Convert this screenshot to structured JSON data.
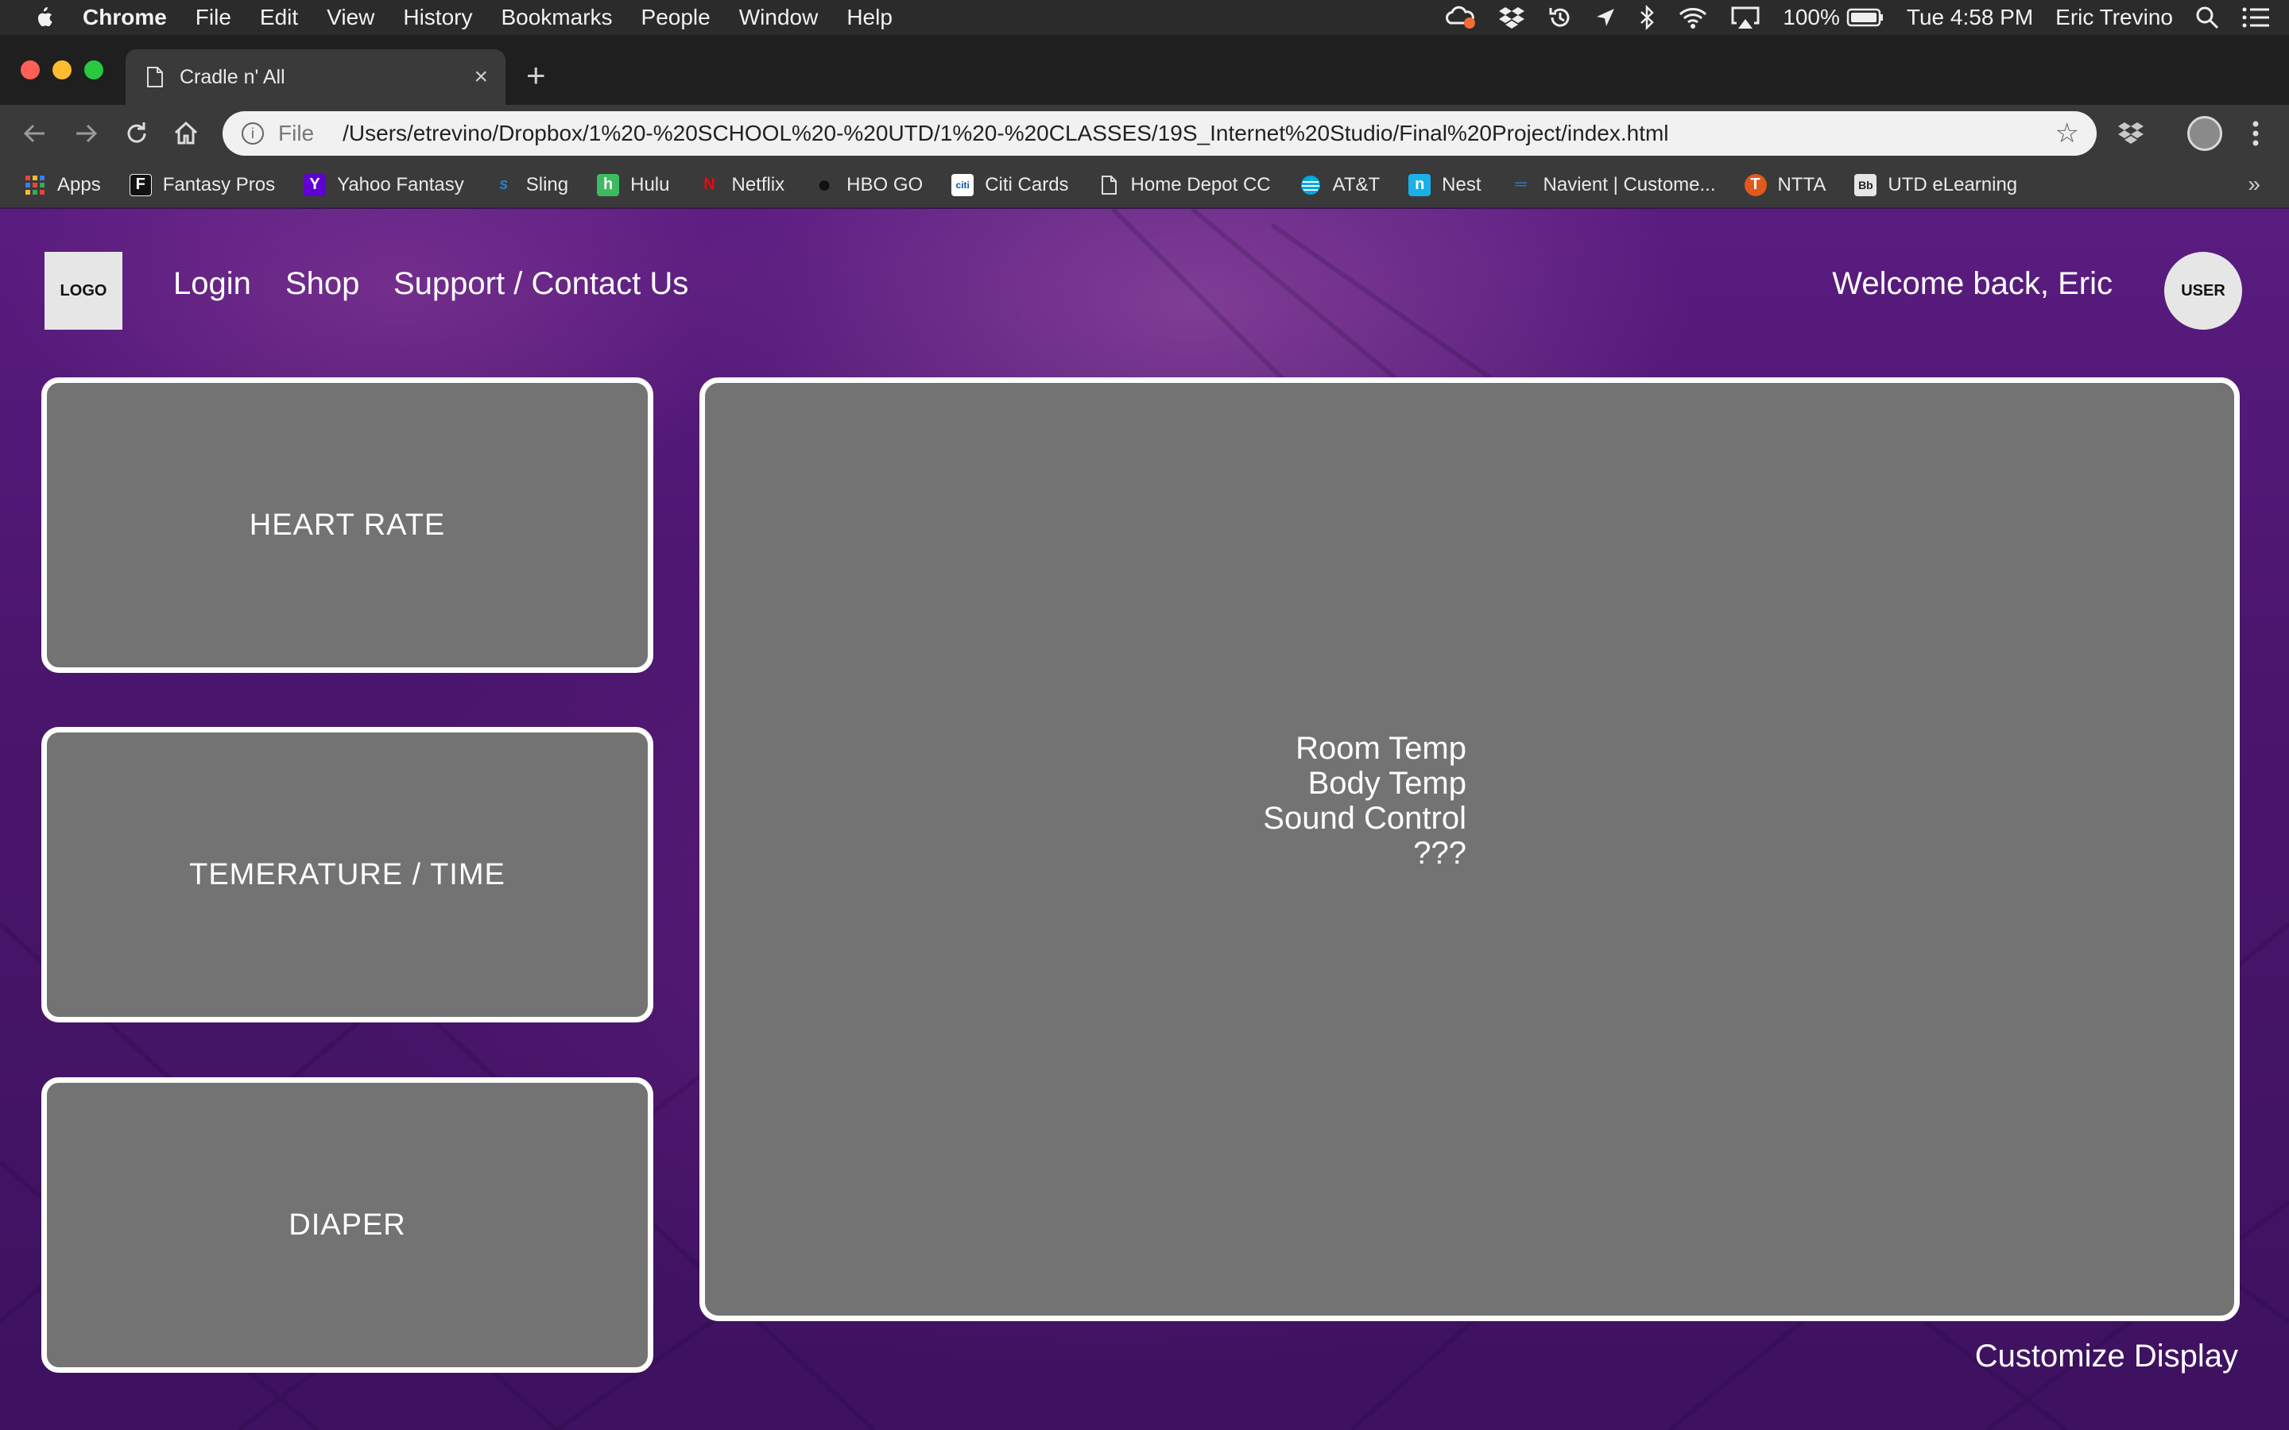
{
  "menubar": {
    "app_name": "Chrome",
    "items": [
      "File",
      "Edit",
      "View",
      "History",
      "Bookmarks",
      "People",
      "Window",
      "Help"
    ],
    "battery": "100%",
    "clock": "Tue 4:58 PM",
    "user": "Eric Trevino"
  },
  "tab": {
    "title": "Cradle n' All",
    "close_glyph": "×",
    "new_tab_glyph": "+"
  },
  "omnibox": {
    "scheme": "File",
    "url": "/Users/etrevino/Dropbox/1%20-%20SCHOOL%20-%20UTD/1%20-%20CLASSES/19S_Internet%20Studio/Final%20Project/index.html"
  },
  "bookmarks": [
    {
      "label": "Apps",
      "icon": "apps-grid-icon",
      "color": "#e8453c"
    },
    {
      "label": "Fantasy Pros",
      "icon": "fantasy-pros-icon",
      "glyph": "F",
      "color": "#111111"
    },
    {
      "label": "Yahoo Fantasy",
      "icon": "yahoo-icon",
      "glyph": "Y",
      "color": "#5f01d1"
    },
    {
      "label": "Sling",
      "icon": "sling-icon",
      "glyph": "s",
      "color": "#2a7fd4"
    },
    {
      "label": "Hulu",
      "icon": "hulu-icon",
      "glyph": "h",
      "color": "#3dbb61"
    },
    {
      "label": "Netflix",
      "icon": "netflix-icon",
      "glyph": "N",
      "color": "#e50914"
    },
    {
      "label": "HBO GO",
      "icon": "hbo-icon",
      "glyph": "●",
      "color": "#222222"
    },
    {
      "label": "Citi Cards",
      "icon": "citi-icon",
      "glyph": "citi",
      "color": "#ffffff"
    },
    {
      "label": "Home Depot CC",
      "icon": "document-icon",
      "glyph": "",
      "color": "#3a3a3a"
    },
    {
      "label": "AT&T",
      "icon": "att-icon",
      "glyph": "",
      "color": "#00a8e0"
    },
    {
      "label": "Nest",
      "icon": "nest-icon",
      "glyph": "n",
      "color": "#1ab0e8"
    },
    {
      "label": "Navient | Custome...",
      "icon": "navient-icon",
      "glyph": "═",
      "color": "#3a3a3a"
    },
    {
      "label": "NTTA",
      "icon": "ntta-icon",
      "glyph": "T",
      "color": "#e05a1c"
    },
    {
      "label": "UTD eLearning",
      "icon": "blackboard-icon",
      "glyph": "Bb",
      "color": "#e6e6e6"
    }
  ],
  "bookmarks_more": "»",
  "page": {
    "logo": "LOGO",
    "nav": [
      "Login",
      "Shop",
      "Support / Contact Us"
    ],
    "welcome": "Welcome back, Eric",
    "avatar": "USER",
    "cards": [
      "HEART RATE",
      "TEMERATURE / TIME",
      "DIAPER"
    ],
    "main_list": [
      "Room Temp",
      "Body Temp",
      "Sound Control",
      "???"
    ],
    "customize": "Customize Display"
  },
  "colors": {
    "page_bg": "#4a156c",
    "card_fill": "#737373",
    "card_border": "#ffffff"
  }
}
